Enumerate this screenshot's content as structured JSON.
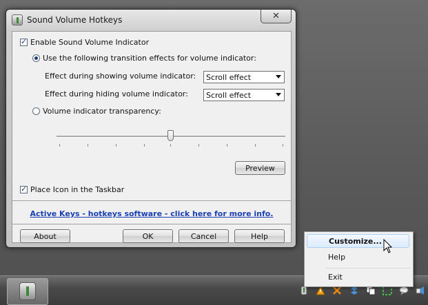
{
  "window": {
    "title": "Sound Volume Hotkeys",
    "close_label": "✕"
  },
  "options": {
    "enable_indicator": {
      "label": "Enable Sound Volume Indicator",
      "checked": true
    },
    "use_transitions": {
      "label": "Use the following transition effects for volume indicator:",
      "selected": true
    },
    "showing_effect": {
      "label": "Effect during showing volume indicator:",
      "value": "Scroll effect"
    },
    "hiding_effect": {
      "label": "Effect during hiding volume indicator:",
      "value": "Scroll effect"
    },
    "transparency": {
      "label": "Volume indicator transparency:",
      "selected": false,
      "level_percent": 50
    },
    "place_icon": {
      "label": "Place Icon in the Taskbar",
      "checked": true
    }
  },
  "buttons": {
    "preview": "Preview",
    "about": "About",
    "ok": "OK",
    "cancel": "Cancel",
    "help": "Help"
  },
  "link": {
    "text": "Active Keys - hotkeys software - click here for more info."
  },
  "context_menu": {
    "items": [
      {
        "label": "Customize..."
      },
      {
        "label": "Help"
      },
      {
        "label": "Exit"
      }
    ]
  },
  "tray_icons": [
    "sound-hotkeys-icon",
    "warning-icon",
    "network-icon",
    "dropbox-icon",
    "copy-icon",
    "sync-icon",
    "chat-icon",
    "speaker-icon"
  ]
}
